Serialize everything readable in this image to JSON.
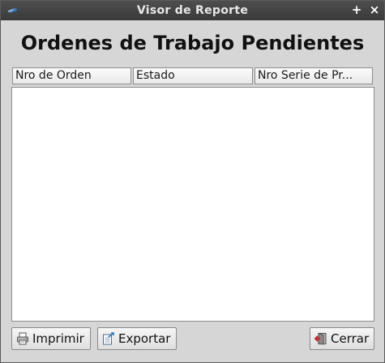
{
  "window": {
    "title": "Visor de Reporte",
    "maximize_label": "+",
    "close_label": "×"
  },
  "report": {
    "title": "Ordenes de Trabajo Pendientes"
  },
  "table": {
    "columns": [
      "Nro de Orden",
      "Estado",
      "Nro Serie de Pr..."
    ],
    "rows": []
  },
  "buttons": {
    "print_label": "Imprimir",
    "export_label": "Exportar",
    "close_label": "Cerrar"
  },
  "icons": {
    "app": "app-icon",
    "print": "printer-icon",
    "export": "export-icon",
    "close": "exit-door-icon"
  }
}
